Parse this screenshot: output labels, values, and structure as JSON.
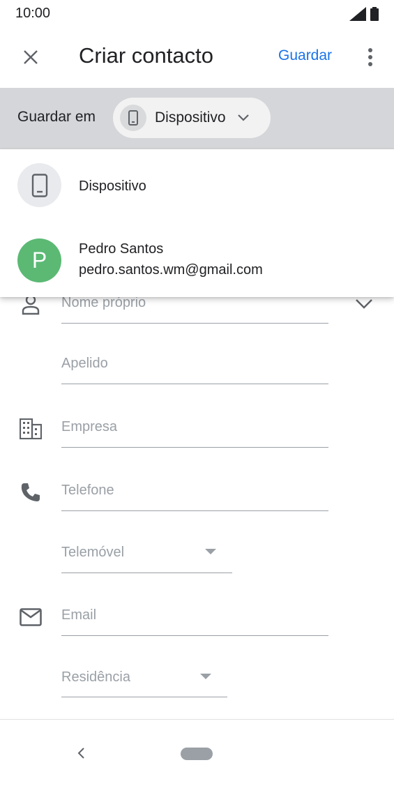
{
  "status": {
    "time": "10:00",
    "icons": [
      "signal-icon",
      "battery-icon"
    ]
  },
  "app_bar": {
    "title": "Criar contacto",
    "save_label": "Guardar",
    "close_icon": "close-icon",
    "more_icon": "more-vert-icon"
  },
  "save_to": {
    "label": "Guardar em",
    "selected": "Dispositivo",
    "icon": "phone-icon"
  },
  "dropdown": {
    "items": [
      {
        "label": "Dispositivo",
        "icon": "phone-icon"
      },
      {
        "initial": "P",
        "name": "Pedro Santos",
        "email": "pedro.santos.wm@gmail.com",
        "avatar_color": "#5bb974"
      }
    ]
  },
  "form": {
    "first_name_placeholder": "Nome próprio",
    "last_name_placeholder": "Apelido",
    "company_placeholder": "Empresa",
    "phone_placeholder": "Telefone",
    "phone_type": "Telemóvel",
    "email_placeholder": "Email",
    "email_type": "Residência"
  },
  "colors": {
    "accent": "#1a73e8",
    "scrim_bar": "#d5d6d9",
    "placeholder": "#9aa0a6"
  }
}
